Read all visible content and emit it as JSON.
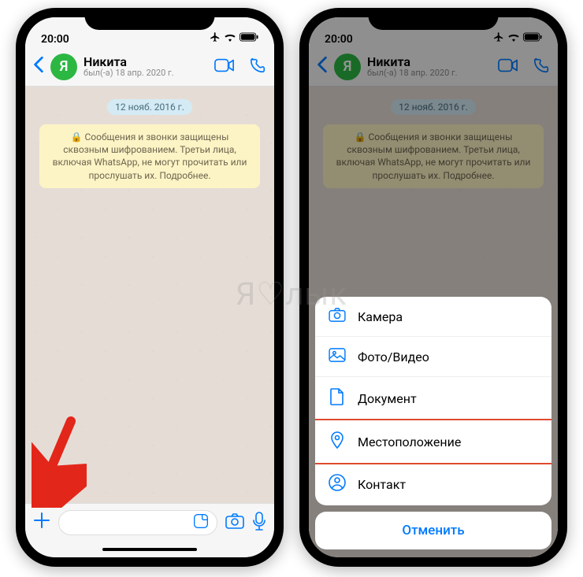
{
  "status": {
    "time": "20:00"
  },
  "header": {
    "contact_name": "Никита",
    "contact_status": "был(-а) 18 апр. 2020 г.",
    "avatar_letter": "Я"
  },
  "chat": {
    "date": "12 нояб. 2016 г.",
    "encryption_notice": "🔒 Сообщения и звонки защищены сквозным шифрованием. Третьи лица, включая WhatsApp, не могут прочитать или прослушать их. Подробнее."
  },
  "action_sheet": {
    "items": [
      {
        "label": "Камера",
        "icon": "camera"
      },
      {
        "label": "Фото/Видео",
        "icon": "photo"
      },
      {
        "label": "Документ",
        "icon": "document"
      },
      {
        "label": "Местоположение",
        "icon": "location",
        "highlight": true
      },
      {
        "label": "Контакт",
        "icon": "contact"
      }
    ],
    "cancel": "Отменить"
  },
  "watermark": "Я♡лык"
}
